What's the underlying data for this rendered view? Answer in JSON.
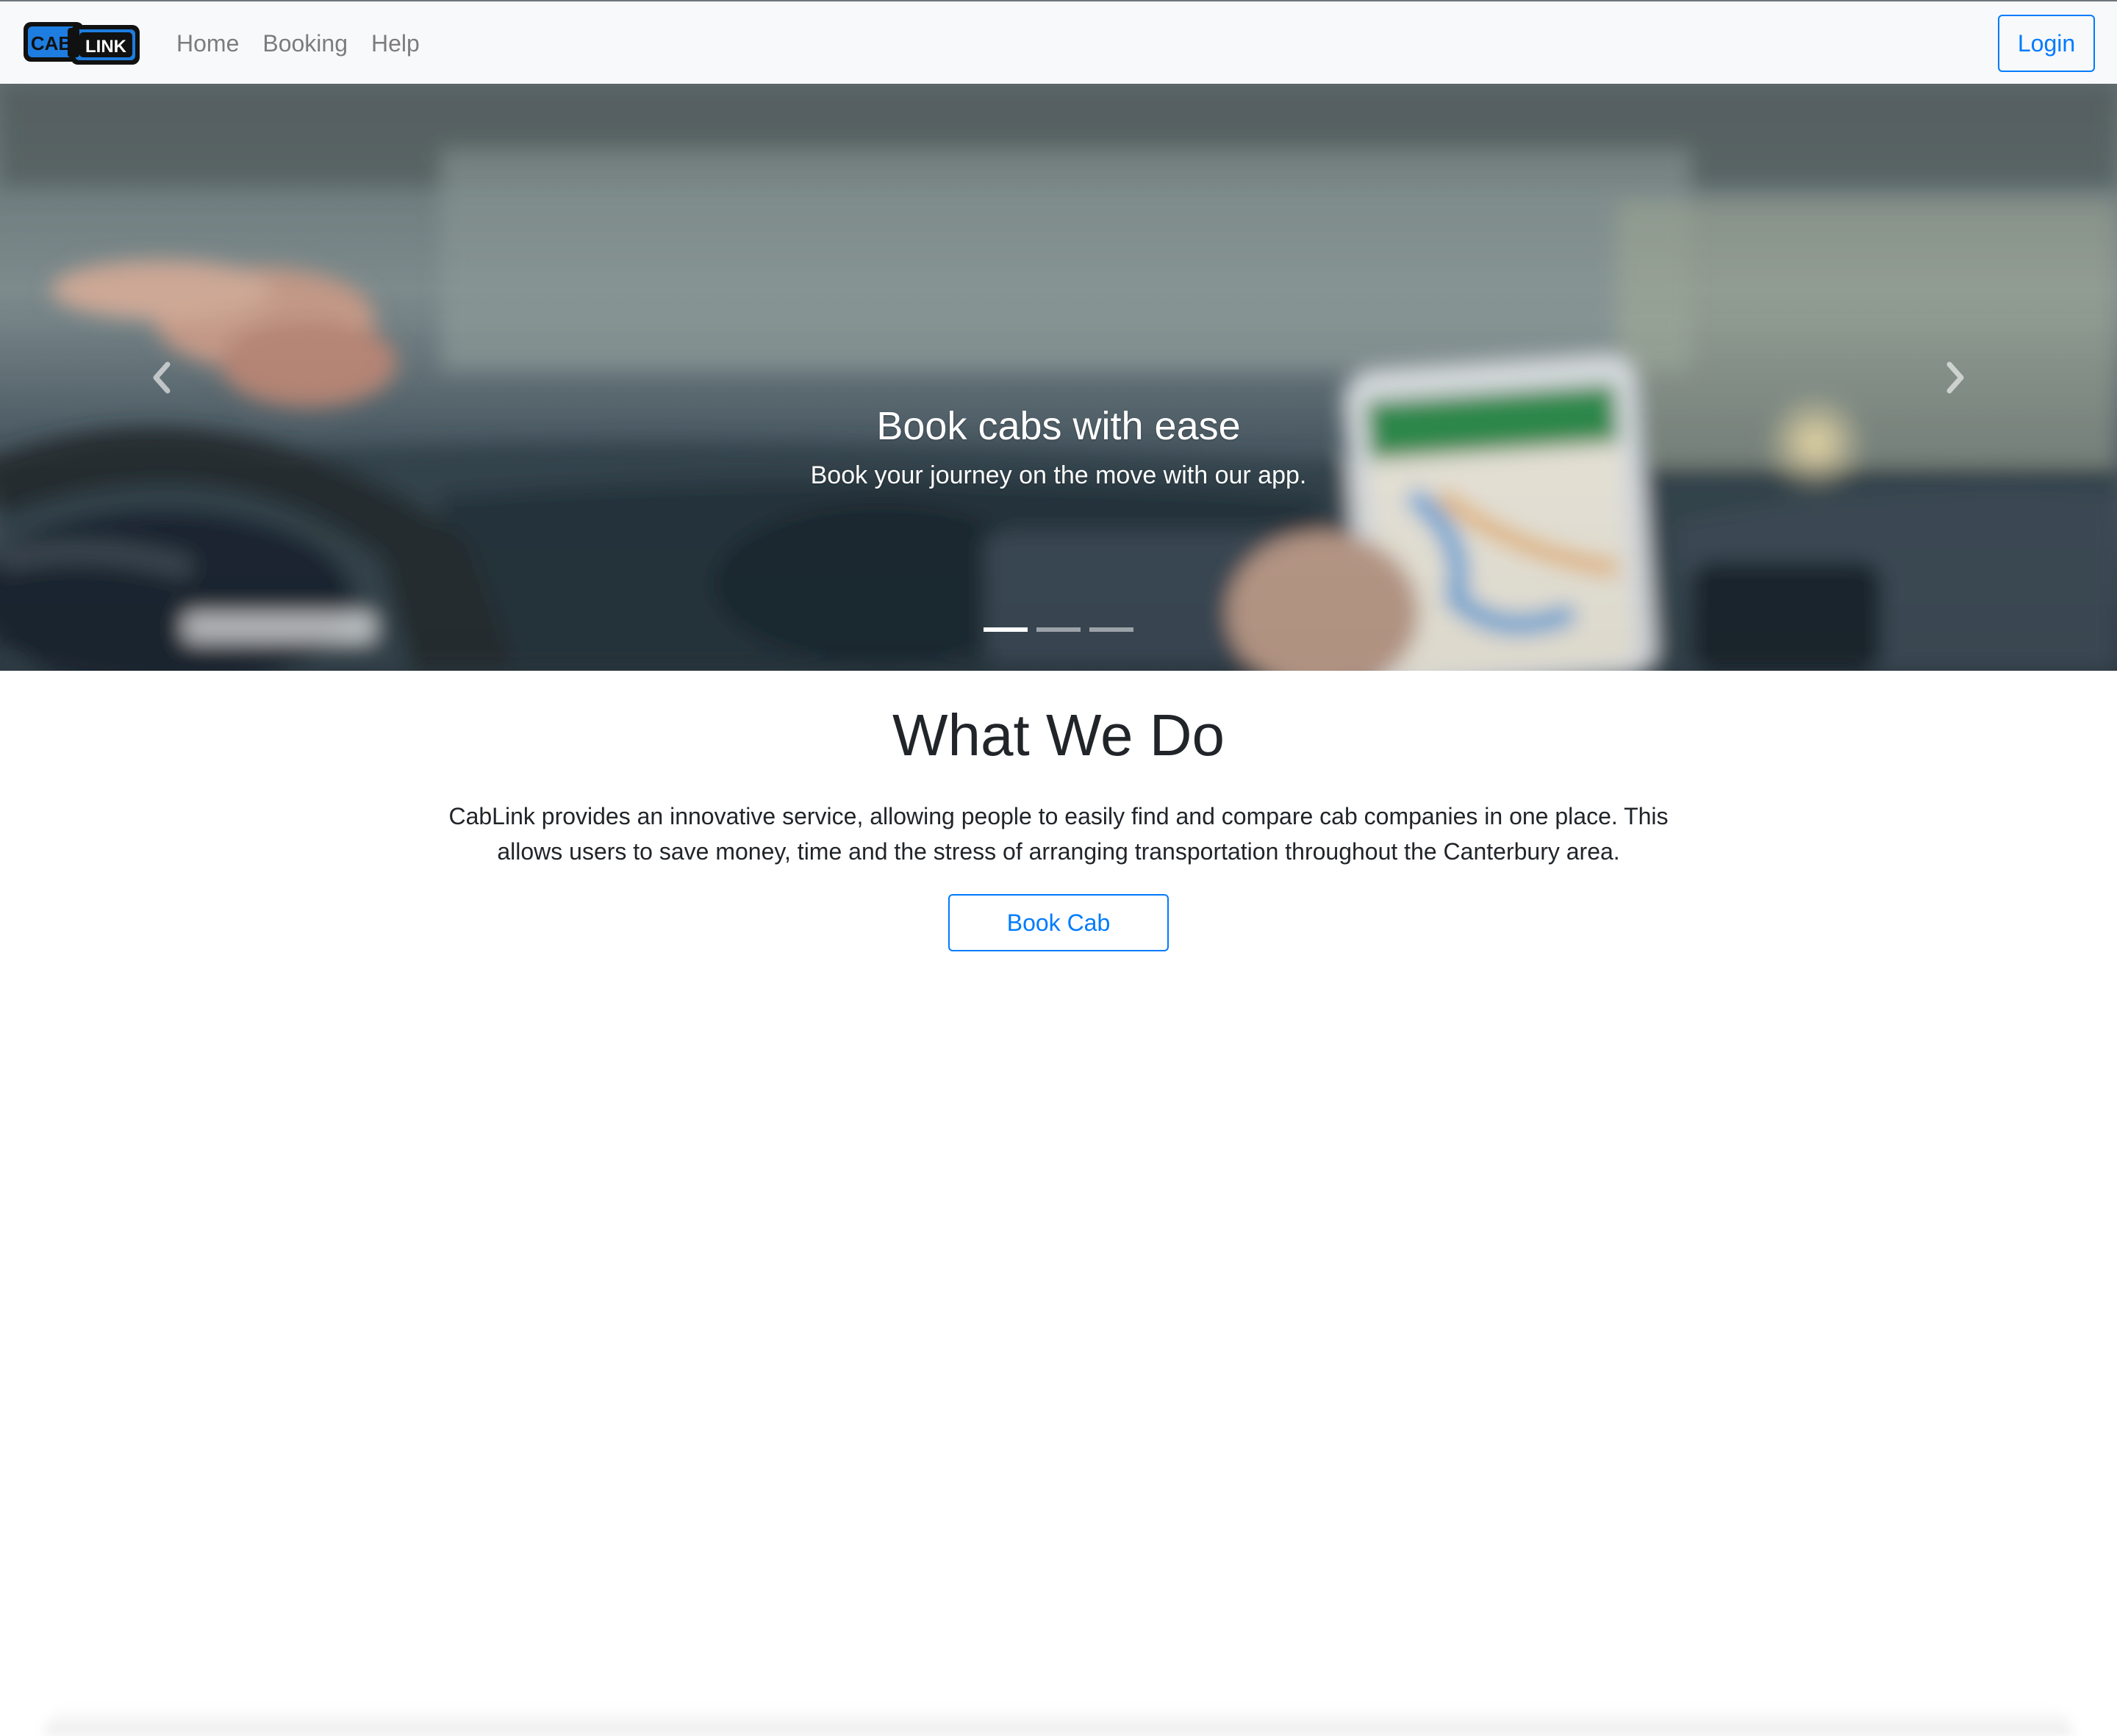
{
  "navbar": {
    "brand": {
      "left_text": "CAB",
      "right_text": "LINK"
    },
    "links": [
      {
        "label": "Home"
      },
      {
        "label": "Booking"
      },
      {
        "label": "Help"
      }
    ],
    "login_label": "Login"
  },
  "carousel": {
    "title": "Book cabs with ease",
    "subtitle": "Book your journey on the move with our app.",
    "slide_count": 3,
    "active_index": 0,
    "prev_icon": "chevron-left-icon",
    "next_icon": "chevron-right-icon"
  },
  "about": {
    "heading": "What We Do",
    "body": "CabLink provides an innovative service, allowing people to easily find and compare cab companies in one place. This allows users to save money, time and the stress of arranging transportation throughout the Canterbury area.",
    "cta_label": "Book Cab"
  },
  "colors": {
    "accent": "#007bff",
    "navbar_bg": "#f8f9fa",
    "logo_dark": "#111111",
    "logo_blue": "#1e7de0"
  }
}
